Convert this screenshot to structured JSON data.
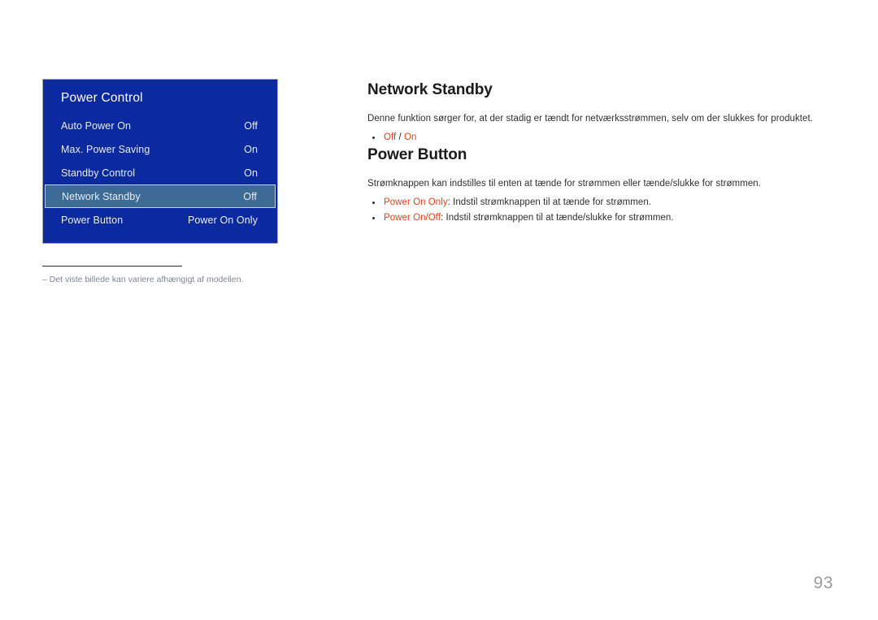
{
  "osd": {
    "title": "Power Control",
    "rows": [
      {
        "label": "Auto Power On",
        "value": "Off",
        "selected": false
      },
      {
        "label": "Max. Power Saving",
        "value": "On",
        "selected": false
      },
      {
        "label": "Standby Control",
        "value": "On",
        "selected": false
      },
      {
        "label": "Network Standby",
        "value": "Off",
        "selected": true
      },
      {
        "label": "Power Button",
        "value": "Power On Only",
        "selected": false
      }
    ],
    "panel_color": "#0b2aa0",
    "highlight_color": "#3d6b96"
  },
  "footnote": {
    "text": "‒ Det viste billede kan variere afhængigt af modellen."
  },
  "sections": [
    {
      "heading": "Network Standby",
      "body": "Denne funktion sørger for, at der stadig er tændt for netværksstrømmen, selv om der slukkes for produktet.",
      "bullets": [
        {
          "term": "Off",
          "separator": " / ",
          "term2": "On",
          "rest": ""
        }
      ]
    },
    {
      "heading": "Power Button",
      "body": "Strømknappen kan indstilles til enten at tænde for strømmen eller tænde/slukke for strømmen.",
      "bullets": [
        {
          "term": "Power On Only",
          "separator": "",
          "term2": "",
          "rest": ": Indstil strømknappen til at tænde for strømmen."
        },
        {
          "term": "Power On/Off",
          "separator": "",
          "term2": "",
          "rest": ": Indstil strømknappen til at tænde/slukke for strømmen."
        }
      ]
    }
  ],
  "accent_color": "#e8420f",
  "page": {
    "number": "93"
  }
}
